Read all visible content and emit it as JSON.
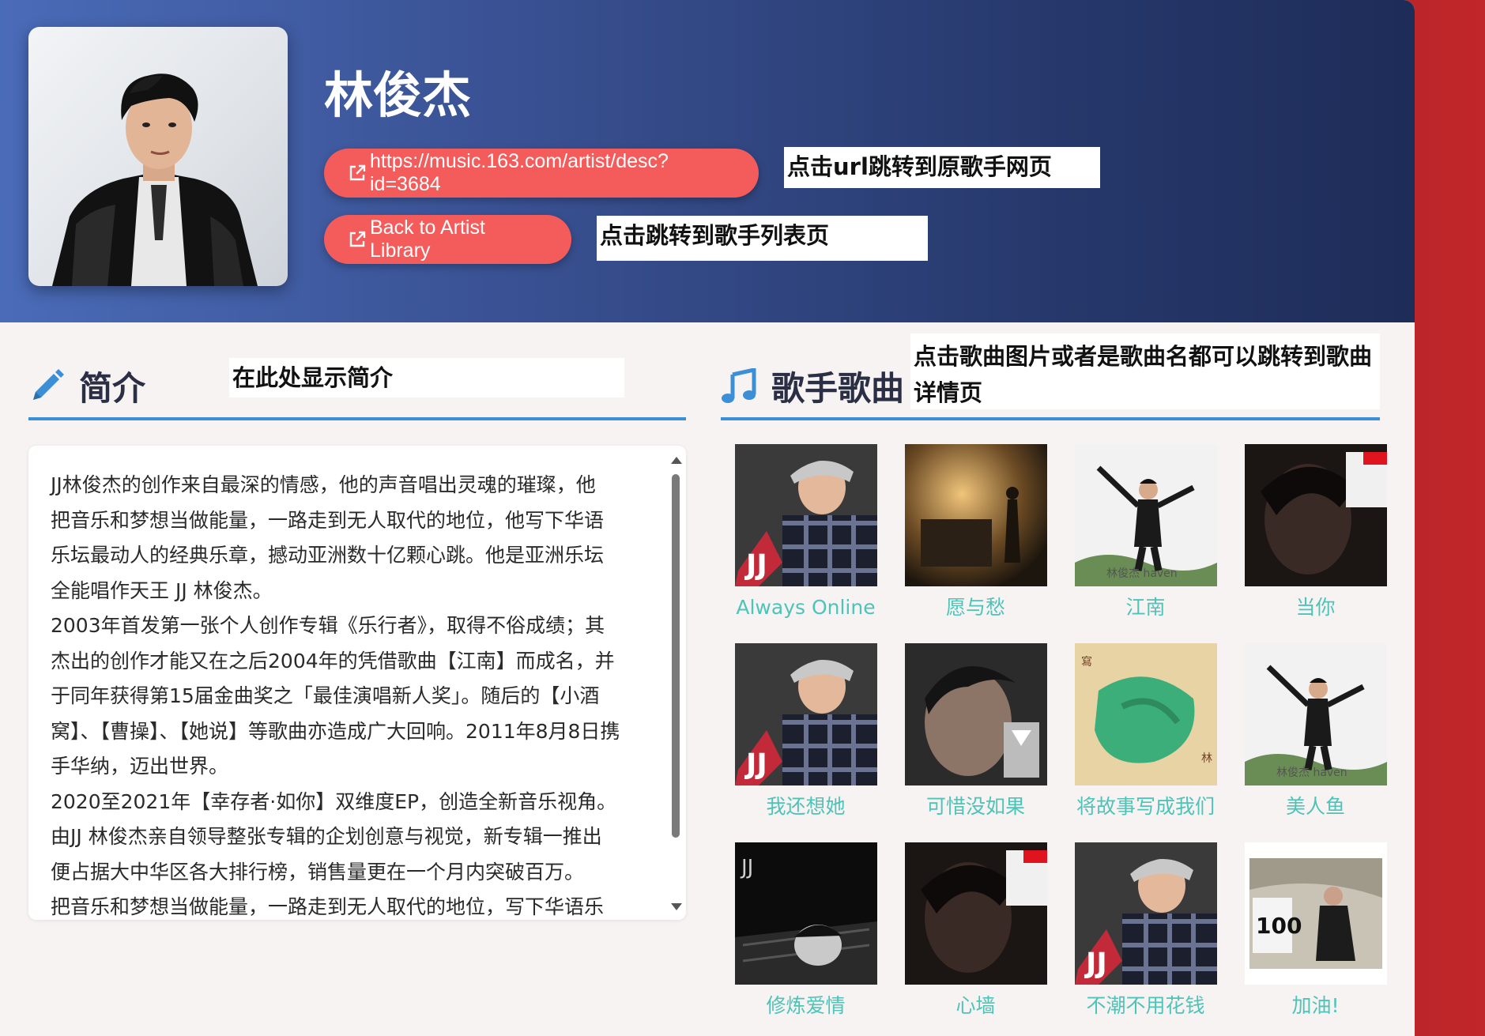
{
  "artist": {
    "name": "林俊杰",
    "url_button": "https://music.163.com/artist/desc?id=3684",
    "back_button": "Back to Artist Library"
  },
  "notes": {
    "url": "点击url跳转到原歌手网页",
    "back": "点击跳转到歌手列表页",
    "intro": "在此处显示简介",
    "songs": "点击歌曲图片或者是歌曲名都可以跳转到歌曲详情页"
  },
  "intro": {
    "title": "简介",
    "text": "JJ林俊杰的创作来自最深的情感，他的声音唱出灵魂的璀璨，他\n把音乐和梦想当做能量，一路走到无人取代的地位，他写下华语\n乐坛最动人的经典乐章，撼动亚洲数十亿颗心跳。他是亚洲乐坛\n全能唱作天王 JJ 林俊杰。\n2003年首发第一张个人创作专辑《乐行者》，取得不俗成绩；其\n杰出的创作才能又在之后2004年的凭借歌曲【江南】而成名，并\n于同年获得第15届金曲奖之「最佳演唱新人奖」。随后的【小酒\n窝】、【曹操】、【她说】等歌曲亦造成广大回响。2011年8月8日携\n手华纳，迈出世界。\n2020至2021年【幸存者·如你】双维度EP，创造全新音乐视角。\n由JJ 林俊杰亲自领导整张专辑的企划创意与视觉，新专辑一推出\n便占据大中华区各大排行榜，销售量更在一个月内突破百万。\n把音乐和梦想当做能量，一路走到无人取代的地位，写下华语乐"
  },
  "songs": {
    "title": "歌手歌曲",
    "items": [
      {
        "name": "Always Online",
        "cover": "a"
      },
      {
        "name": "愿与愁",
        "cover": "b"
      },
      {
        "name": "江南",
        "cover": "c"
      },
      {
        "name": "当你",
        "cover": "d"
      },
      {
        "name": "我还想她",
        "cover": "a"
      },
      {
        "name": "可惜没如果",
        "cover": "e"
      },
      {
        "name": "将故事写成我们",
        "cover": "f"
      },
      {
        "name": "美人鱼",
        "cover": "c"
      },
      {
        "name": "修炼爱情",
        "cover": "g"
      },
      {
        "name": "心墙",
        "cover": "d"
      },
      {
        "name": "不潮不用花钱",
        "cover": "a"
      },
      {
        "name": "加油!",
        "cover": "h"
      }
    ]
  },
  "colors": {
    "header_start": "#4a6bb8",
    "header_end": "#1e2c58",
    "pill": "#f45b5b",
    "accent_rule": "#3b8fd6",
    "song_link": "#4cc4b8"
  },
  "icons": {
    "external_link": "external-link-icon",
    "intro": "pencil-icon",
    "songs": "music-note-icon"
  }
}
